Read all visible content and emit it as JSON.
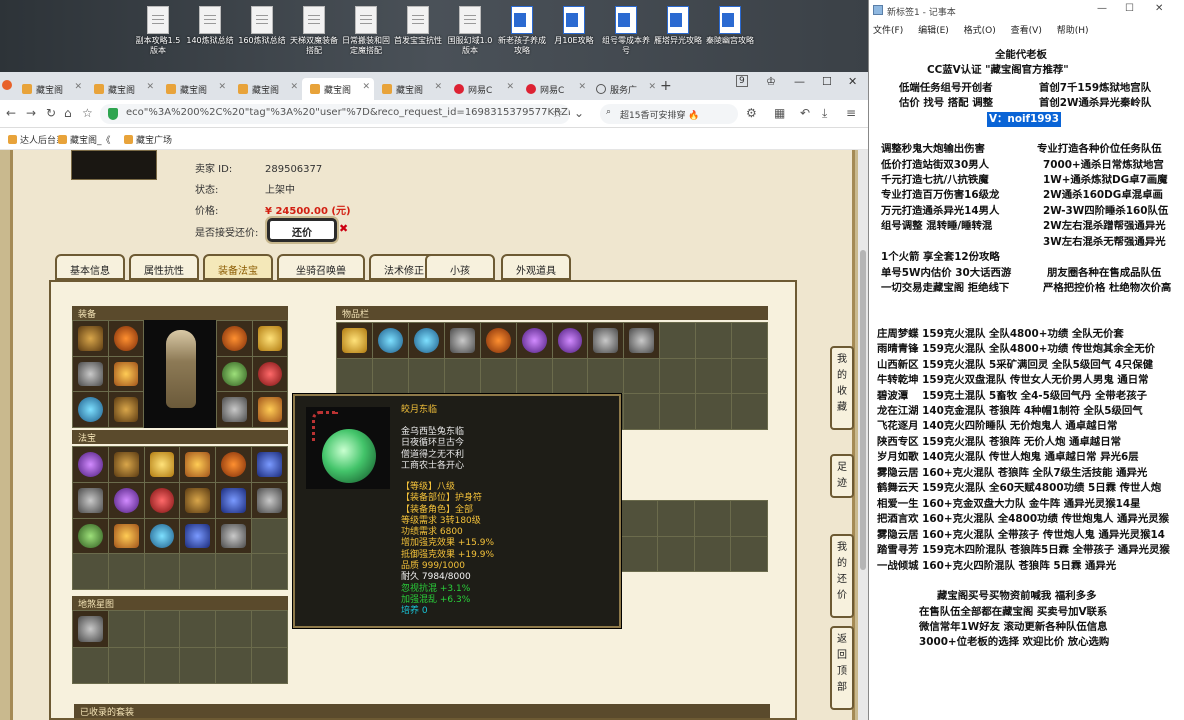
{
  "desktop": {
    "icons": [
      {
        "label": "副本攻略1.5版本",
        "type": "doc"
      },
      {
        "label": "140炼狱总结",
        "type": "doc"
      },
      {
        "label": "160炼狱总结",
        "type": "doc"
      },
      {
        "label": "天梯双魔装备搭配",
        "type": "doc"
      },
      {
        "label": "日常搬装和固定魔搭配",
        "type": "doc"
      },
      {
        "label": "首发宝宝抗性",
        "type": "doc"
      },
      {
        "label": "国服幻域1.0版本",
        "type": "doc"
      },
      {
        "label": "新老孩子养成攻略",
        "type": "word"
      },
      {
        "label": "月10E攻略",
        "type": "word"
      },
      {
        "label": "组号零成本养号",
        "type": "word"
      },
      {
        "label": "雁塔异光攻略",
        "type": "word"
      },
      {
        "label": "秦陵幽宫攻略",
        "type": "word"
      }
    ]
  },
  "browser": {
    "tabs": [
      {
        "label": "藏宝阁"
      },
      {
        "label": "藏宝阁"
      },
      {
        "label": "藏宝阁"
      },
      {
        "label": "藏宝阁"
      },
      {
        "label": "藏宝阁"
      },
      {
        "label": "藏宝阁"
      },
      {
        "label": "网易C"
      },
      {
        "label": "网易C"
      },
      {
        "label": "服务广"
      }
    ],
    "tab_count_badge": "9",
    "url": "eco\"%3A%200%2C%20\"tag\"%3A%20\"user\"%7D&reco_request_id=1698315379577KRZDZ",
    "search_text": "超15香可安排穿",
    "bookmarks": [
      "达人后台系",
      "藏宝阁_《",
      "藏宝广场"
    ]
  },
  "listing": {
    "seller_id_label": "卖家 ID:",
    "seller_id": "289506377",
    "status_label": "状态:",
    "status": "上架中",
    "price_label": "价格:",
    "price": "¥ 24500.00 (元)",
    "bargain_label": "是否接受还价:",
    "bargain_button": "还价"
  },
  "tabs": [
    "基本信息",
    "属性抗性",
    "装备法宝",
    "坐骑召唤兽",
    "法术修正",
    "小孩",
    "外观道具"
  ],
  "sections": {
    "equip": "装备",
    "fabao": "法宝",
    "inventory": "物品栏",
    "lingbao": "地煞星图",
    "collected": "已收录的套装"
  },
  "tooltip": {
    "name": "皎月东临",
    "poem": [
      "金乌西坠兔东临",
      "日夜循环旦古今",
      "僧道得之无不利",
      "工商农士各开心"
    ],
    "stats_yellow": [
      "【等级】八级",
      "【装备部位】护身符",
      "【装备角色】全部",
      "等级需求 3转180级",
      "功绩需求 6800",
      "增加强克效果 +15.9%",
      "抵御强克效果 +19.9%",
      "品质 999/1000"
    ],
    "durability": "耐久 7984/8000",
    "stats_green": [
      "忽视抗混 +3.1%",
      "加强混乱 +6.3%"
    ],
    "train": "培养 0"
  },
  "sidenav": [
    {
      "label": "我的收藏"
    },
    {
      "label": "足迹"
    },
    {
      "label": "我的还价"
    },
    {
      "label": "返回顶部"
    }
  ],
  "notepad": {
    "title": "新标签1 - 记事本",
    "menu": [
      "文件(F)",
      "编辑(E)",
      "格式(O)",
      "查看(V)",
      "帮助(H)"
    ],
    "lines": [
      "全能代老板",
      "CC蓝V认证 \"藏宝阁官方推荐\"",
      "低端任务组号开创者",
      "首创7千159炼狱地宫队",
      "估价 找号 搭配 调整",
      "首创2W通杀异光秦岭队",
      "V：noif1993",
      "调整秒鬼大炮输出伤害",
      "专业打造各种价位任务队伍",
      "低价打造站街双30男人",
      "7000+通杀日常炼狱地宫",
      "千元打造七抗/八抗铁魔",
      "1W+通杀炼狱DG卓7画魔",
      "专业打造百万伤害16级龙",
      "2W通杀160DG卓混卓画",
      "万元打造通杀异光14男人",
      "2W-3W四阶睡杀160队伍",
      "组号调整 混转睡/睡转混",
      "2W左右混杀蹭帮强通异光",
      "3W左右混杀无帮强通异光",
      "1个火箭 享全套12份攻略",
      "单号5W内估价 30大话西游",
      "朋友圈各种在售成品队伍",
      "一切交易走藏宝阁 拒绝线下",
      "严格把控价格 杜绝物次价高",
      "庄周梦蝶 159克火混队 全队4800+功绩 全队无价套",
      "雨晴青锋 159克火混队 全队4800+功绩 传世炮其余全无价",
      "山西新区 159克火混队 5采矿满回灵 全队5级回气 4只保健",
      "牛转乾坤 159克火双盘混队 传世女人无价男人男鬼 通日常",
      "碧波潭　 159克土混队 5畜牧 全4-5级回气丹 全带老孩子",
      "龙在江湖 140克金混队 苍狼阵 4种帽1制符 全队5级回气",
      "飞花逐月 140克火四阶睡队 无价炮鬼人 通卓越日常",
      "陕西专区 159克火混队 苍狼阵 无价人炮 通卓越日常",
      "岁月如歌 140克火混队 传世人炮鬼 通卓越日常 异光6层",
      "雾隐云居 160+克火混队 苍狼阵 全队7级生活技能 通异光",
      "鹤舞云天 159克火混队 全60天赋4800功绩 5日霖 传世人炮",
      "相爱一生 160+克金双盘大力队 金牛阵 通异光灵猴14星",
      "把酒言欢 160+克火混队 全4800功绩 传世炮鬼人 通异光灵猴",
      "雾隐云居 160+克火混队 全带孩子 传世炮人鬼 通异光灵猴14",
      "踏雪寻芳 159克木四阶混队 苍狼阵5日霖 全带孩子 通异光灵猴",
      "一战倾城 160+克火四阶混队 苍狼阵 5日霖 通异光",
      "藏宝阁买号买物资前喊我 福利多多",
      "在售队伍全部都在藏宝阁 买卖号加V联系",
      "微信常年1W好友 滚动更新各种队伍信息",
      "3000+位老板的选择 欢迎比价 放心选购"
    ]
  }
}
